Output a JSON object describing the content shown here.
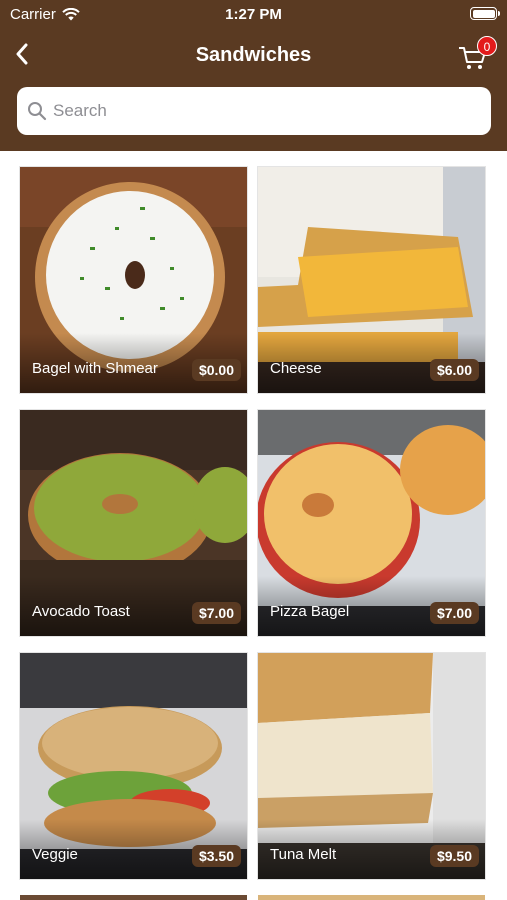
{
  "status": {
    "carrier": "Carrier",
    "time": "1:27 PM"
  },
  "nav": {
    "title": "Sandwiches",
    "cart_count": "0"
  },
  "search": {
    "placeholder": "Search"
  },
  "colors": {
    "header": "#5a3a22",
    "badge": "#e31b1b",
    "price_pill": "#5a3a22"
  },
  "products": [
    {
      "name": "Bagel with Shmear",
      "price": "$0.00"
    },
    {
      "name": "Cheese",
      "price": "$6.00"
    },
    {
      "name": "Avocado Toast",
      "price": "$7.00"
    },
    {
      "name": "Pizza Bagel",
      "price": "$7.00"
    },
    {
      "name": "Veggie",
      "price": "$3.50"
    },
    {
      "name": "Tuna Melt",
      "price": "$9.50"
    }
  ]
}
